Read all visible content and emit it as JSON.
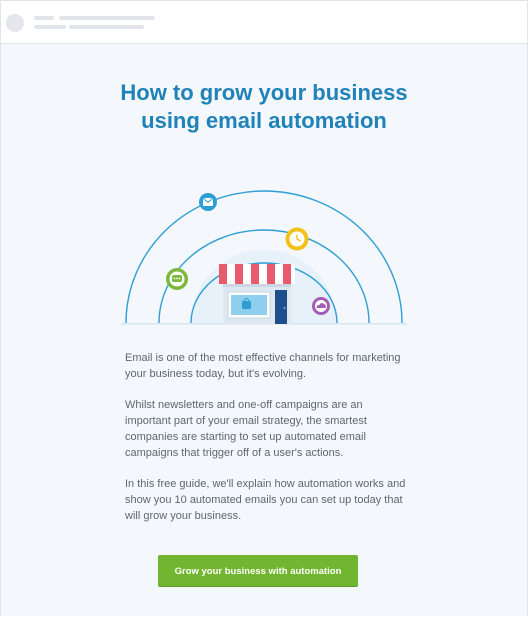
{
  "email": {
    "headline": "How to grow your business using email automation",
    "paragraphs": [
      "Email is one of the most effective channels for marketing your business today, but it's evolving.",
      "Whilst newsletters and one-off campaigns are an important part of your email strategy, the smartest companies are starting to set up automated email campaigns that trigger off of a user's actions.",
      "In this free guide, we'll explain how automation works and show you 10 automated emails you can set up today that will grow your business."
    ],
    "cta_label": "Grow your business with automation"
  },
  "illustration": {
    "icons": [
      "envelope-icon",
      "clock-icon",
      "chat-bubble-icon",
      "cloud-icon",
      "shopping-bag-icon"
    ],
    "colors": {
      "arc": "#2e9fd4",
      "awning_red": "#e85b6d",
      "door": "#1f4e8c",
      "clock": "#f2c21b",
      "chat": "#7cb83b",
      "cloud": "#a35db5"
    }
  },
  "colors": {
    "headline": "#1f82b8",
    "cta": "#72b530",
    "body_text": "#5e6770",
    "background": "#f4f7fb"
  }
}
